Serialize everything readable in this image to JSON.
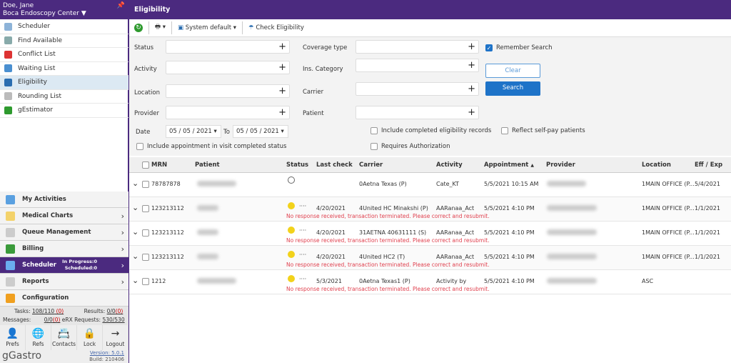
{
  "user": {
    "name": "Doe, Jane",
    "facility": "Boca Endoscopy Center"
  },
  "sidebar": {
    "items": [
      {
        "label": "Scheduler",
        "icon": "calendar-icon",
        "color": "#8db3d8"
      },
      {
        "label": "Find Available",
        "icon": "calendar-search-icon",
        "color": "#8aa"
      },
      {
        "label": "Conflict List",
        "icon": "calendar-conflict-icon",
        "color": "#d33"
      },
      {
        "label": "Waiting List",
        "icon": "calendar-clock-icon",
        "color": "#4a8fd0"
      },
      {
        "label": "Eligibility",
        "icon": "umbrella-icon",
        "color": "#2a6db0"
      },
      {
        "label": "Rounding List",
        "icon": "clipboard-icon",
        "color": "#bbb"
      },
      {
        "label": "gEstimator",
        "icon": "dollar-circle-icon",
        "color": "#2e9a2e"
      }
    ],
    "selected": "Eligibility"
  },
  "panels": [
    {
      "label": "My Activities",
      "icon": "activities-icon",
      "color": "#5aa0e0",
      "chevron": false
    },
    {
      "label": "Medical Charts",
      "icon": "folder-icon",
      "color": "#f3d26a",
      "chevron": true
    },
    {
      "label": "Queue Management",
      "icon": "queue-icon",
      "color": "#ccc",
      "chevron": true
    },
    {
      "label": "Billing",
      "icon": "billing-icon",
      "color": "#3a9a3a",
      "chevron": true
    },
    {
      "label": "Scheduler",
      "icon": "calendar-icon",
      "color": "#6aaef0",
      "chevron": true,
      "in_progress": "In Progress:0",
      "scheduled": "Scheduled:0"
    },
    {
      "label": "Reports",
      "icon": "reports-icon",
      "color": "#ccc",
      "chevron": true
    },
    {
      "label": "Configuration",
      "icon": "lock-gear-icon",
      "color": "#f0a020",
      "chevron": false
    }
  ],
  "stats": {
    "tasks_label": "Tasks:",
    "tasks": "108/110",
    "tasks_red": "(0)",
    "results_label": "Results:",
    "results": "0/0",
    "results_red": "(0)",
    "messages_label": "Messages:",
    "messages": "0/0",
    "messages_red": "(0)",
    "erx_label": "eRX Requests:",
    "erx": "530/530"
  },
  "bottom_icons": [
    {
      "label": "Prefs",
      "glyph": "👤"
    },
    {
      "label": "Refs",
      "glyph": "🌐"
    },
    {
      "label": "Contacts",
      "glyph": "📇"
    },
    {
      "label": "Lock",
      "glyph": "🔒"
    },
    {
      "label": "Logout",
      "glyph": "→"
    }
  ],
  "brand": {
    "logo": "gGastro",
    "version": "Version: 5.0.1",
    "build": "Build: 210406"
  },
  "main": {
    "title": "Eligibility"
  },
  "toolbar": {
    "layout": "System default",
    "check": "Check Eligibility"
  },
  "form": {
    "status": "Status",
    "activity": "Activity",
    "location": "Location",
    "provider": "Provider",
    "date": "Date",
    "date_from": "05 / 05 / 2021",
    "to": "To",
    "date_to": "05 / 05 / 2021",
    "coverage": "Coverage type",
    "ins_category": "Ins. Category",
    "carrier": "Carrier",
    "patient": "Patient",
    "remember": "Remember Search",
    "remember_checked": true,
    "clear": "Clear",
    "search": "Search",
    "include_completed": "Include completed eligibility records",
    "self_pay": "Reflect self-pay patients",
    "requires_auth": "Requires Authorization",
    "include_visit": "Include appointment in visit completed status"
  },
  "table": {
    "headers": {
      "mrn": "MRN",
      "patient": "Patient",
      "status": "Status",
      "last_check": "Last check",
      "carrier": "Carrier",
      "activity": "Activity",
      "appointment": "Appointment",
      "sort": "▲",
      "provider": "Provider",
      "location": "Location",
      "eff": "Eff / Exp"
    },
    "rows": [
      {
        "mrn": "78787878",
        "status": "empty",
        "last_check": "",
        "carrier": "0Aetna Texas (P)",
        "activity": "Cate_KT",
        "appointment": "5/5/2021 10:15 AM",
        "location": "1MAIN OFFICE (P...",
        "eff": "5/4/2021",
        "error": ""
      },
      {
        "mrn": "123213112",
        "status": "pending",
        "dots": "····",
        "last_check": "4/20/2021",
        "carrier": "4United HC Minakshi (P)",
        "activity": "AARanaa_Act",
        "appointment": "5/5/2021 4:10 PM",
        "location": "1MAIN OFFICE (P...",
        "eff": "1/1/2021",
        "error": "No response received, transaction terminated. Please correct and resubmit."
      },
      {
        "mrn": "123213112",
        "status": "pending",
        "dots": "····",
        "last_check": "4/20/2021",
        "carrier": "31AETNA 40631111 (S)",
        "activity": "AARanaa_Act",
        "appointment": "5/5/2021 4:10 PM",
        "location": "1MAIN OFFICE (P...",
        "eff": "1/1/2021",
        "error": "No response received, transaction terminated. Please correct and resubmit."
      },
      {
        "mrn": "123213112",
        "status": "pending",
        "dots": "····",
        "last_check": "4/20/2021",
        "carrier": "4United HC2 (T)",
        "activity": "AARanaa_Act",
        "appointment": "5/5/2021 4:10 PM",
        "location": "1MAIN OFFICE (P...",
        "eff": "1/1/2021",
        "error": "No response received, transaction terminated. Please correct and resubmit."
      },
      {
        "mrn": "1212",
        "status": "pending",
        "dots": "····",
        "last_check": "5/3/2021",
        "carrier": "0Aetna Texas1 (P)",
        "activity": "Activity by",
        "appointment": "5/5/2021 4:10 PM",
        "location": "ASC",
        "eff": "",
        "error": "No response received, transaction terminated. Please correct and resubmit."
      }
    ]
  },
  "colors": {
    "brand_purple": "#4b2a7f",
    "primary_blue": "#1e73c8",
    "error_red": "#e0404e",
    "pending_yellow": "#f2d21b"
  }
}
